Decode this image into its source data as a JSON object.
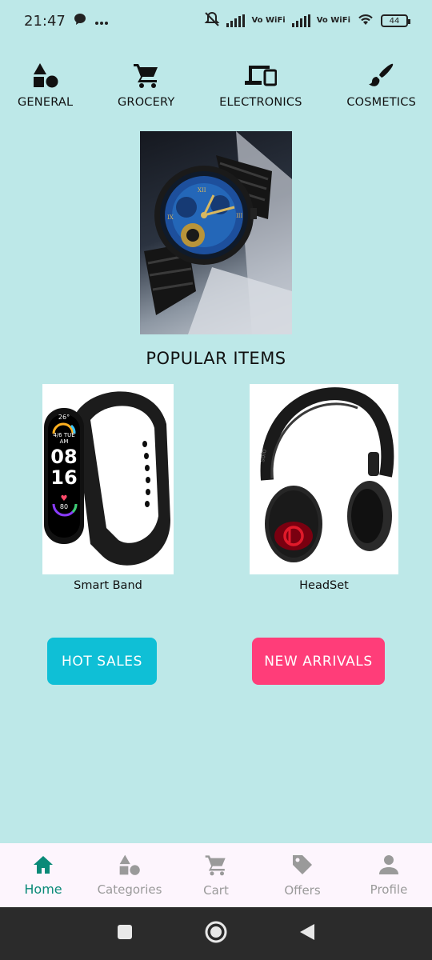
{
  "status_bar": {
    "time": "21:47",
    "network_1": "Vo WiFi",
    "network_2": "Vo WiFi",
    "battery": "44"
  },
  "categories": [
    {
      "label": "GENERAL",
      "icon": "shapes-icon"
    },
    {
      "label": "GROCERY",
      "icon": "cart-icon"
    },
    {
      "label": "ELECTRONICS",
      "icon": "devices-icon"
    },
    {
      "label": "COSMETICS",
      "icon": "brush-icon"
    }
  ],
  "hero": {
    "image": "watch-image"
  },
  "popular": {
    "title": "POPULAR ITEMS",
    "items": [
      {
        "name": "Smart Band",
        "band_time_1": "08",
        "band_time_2": "16",
        "band_date": "4/6 TUE AM",
        "band_temp": "26°",
        "band_hr": "80"
      },
      {
        "name": "HeadSet",
        "brand": "solo"
      }
    ]
  },
  "buttons": {
    "hot_sales": "HOT SALES",
    "new_arrivals": "NEW ARRIVALS"
  },
  "bottom_nav": [
    {
      "label": "Home",
      "icon": "home-icon",
      "active": true
    },
    {
      "label": "Categories",
      "icon": "categories-icon",
      "active": false
    },
    {
      "label": "Cart",
      "icon": "cart-icon",
      "active": false
    },
    {
      "label": "Offers",
      "icon": "tag-icon",
      "active": false
    },
    {
      "label": "Profile",
      "icon": "person-icon",
      "active": false
    }
  ],
  "colors": {
    "background": "#bde8e8",
    "hot_sales": "#0fbfd6",
    "new_arrivals": "#ff3d79",
    "nav_active": "#0a8a78"
  }
}
